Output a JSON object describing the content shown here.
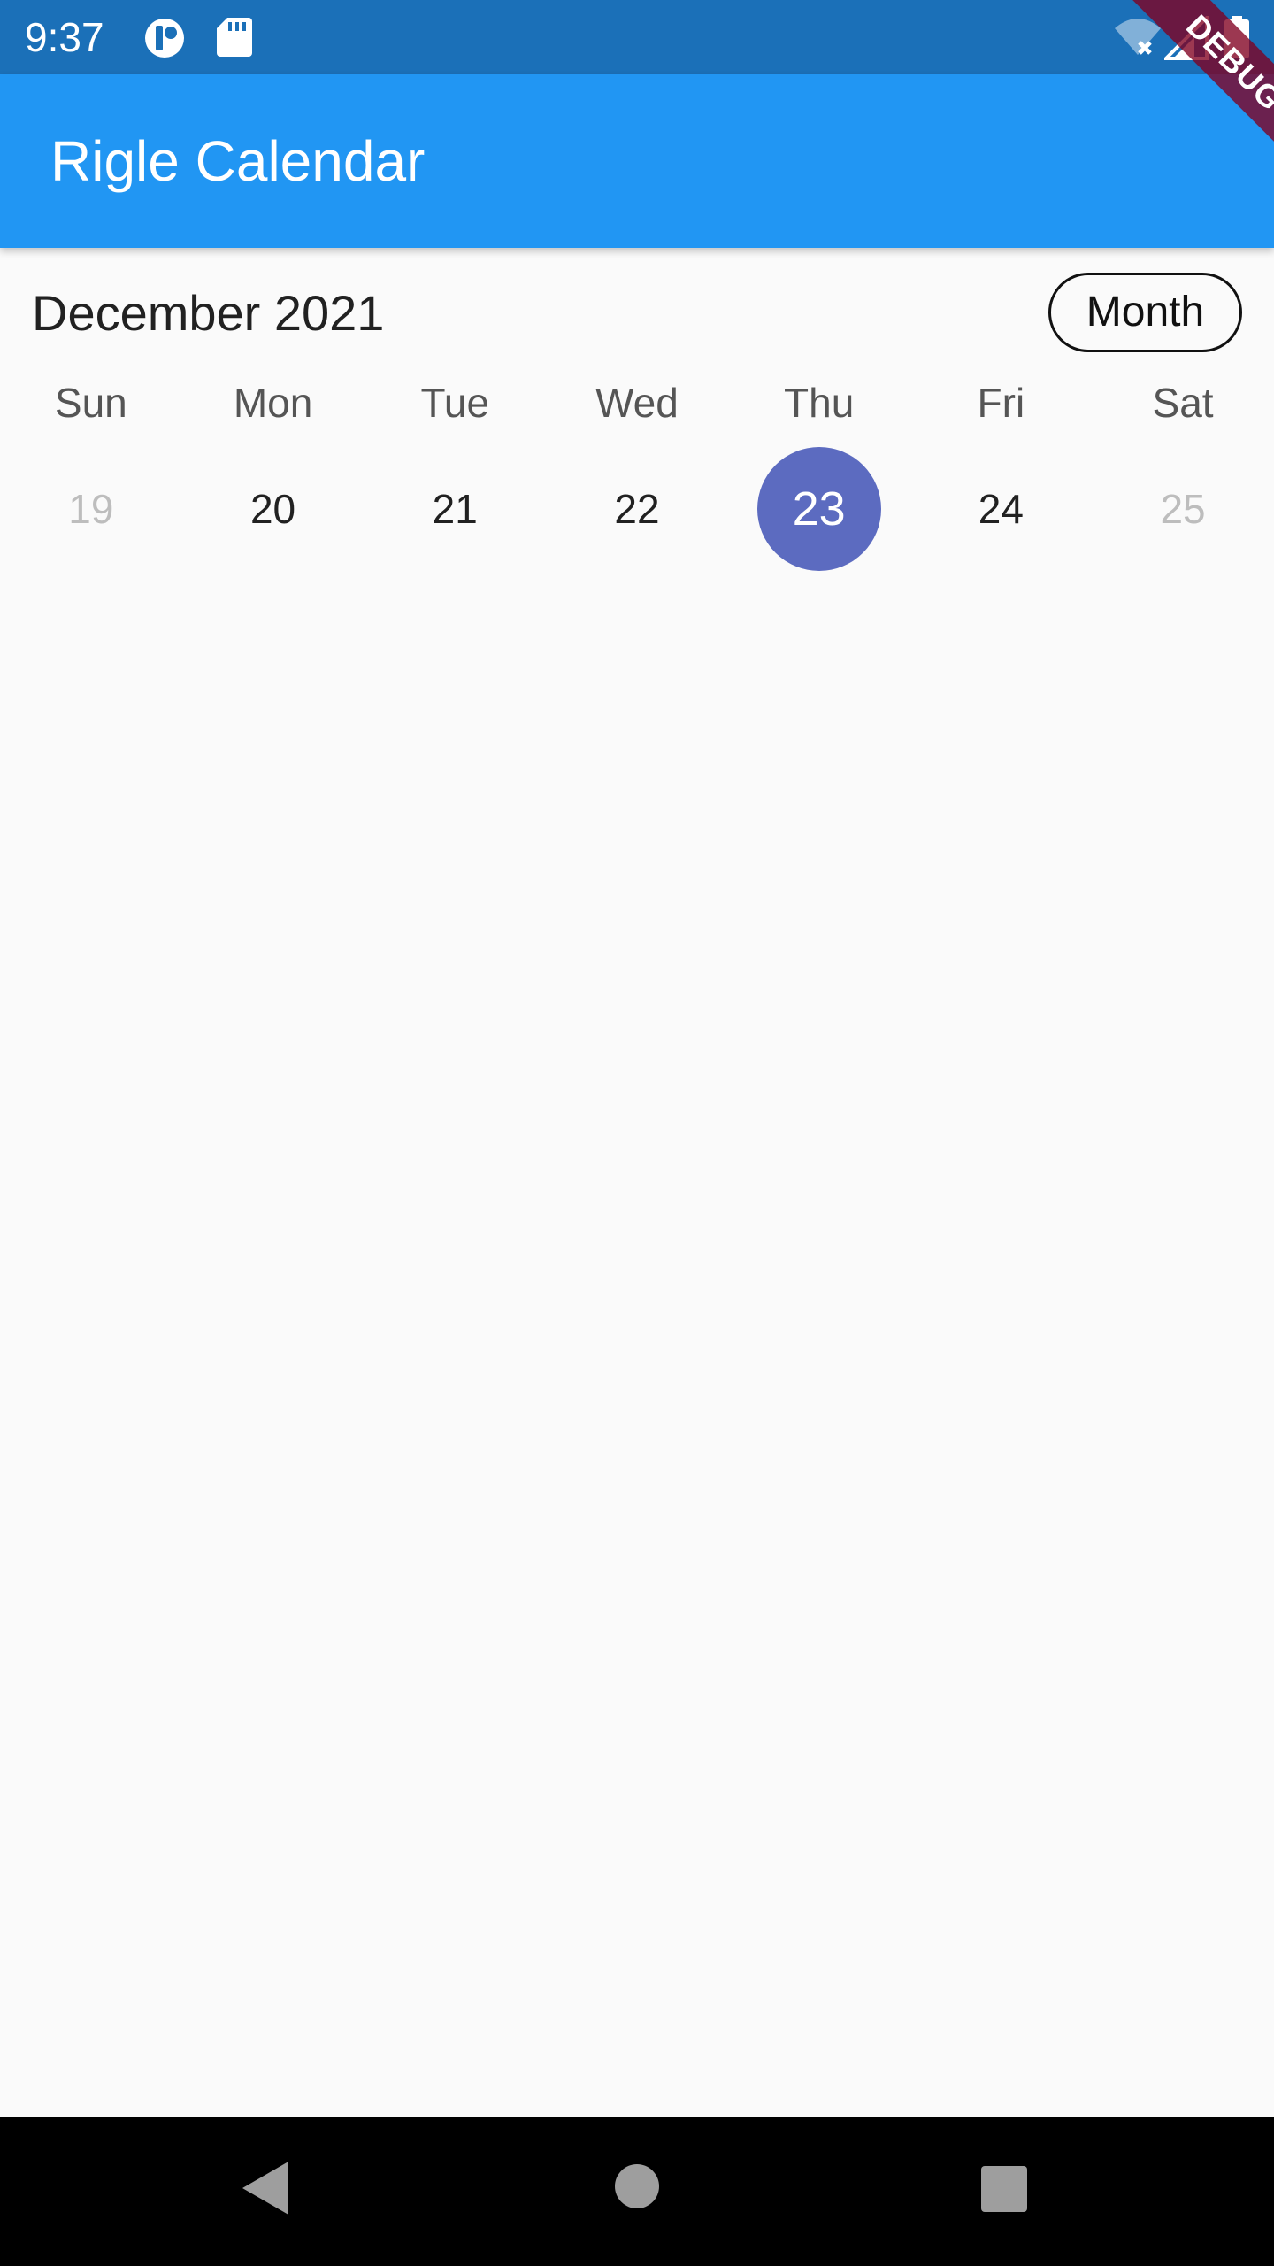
{
  "status_bar": {
    "time": "9:37",
    "background": "#1b70b8",
    "left_icons": [
      "sync-badge-icon",
      "sd-card-icon"
    ],
    "right_icons": [
      "wifi-off-icon",
      "cell-signal-icon",
      "battery-icon"
    ]
  },
  "app_bar": {
    "title": "Rigle Calendar",
    "background": "#2196f3"
  },
  "debug_banner": {
    "label": "DEBUG"
  },
  "calendar": {
    "month_title": "December 2021",
    "view_button": "Month",
    "weekdays": [
      "Sun",
      "Mon",
      "Tue",
      "Wed",
      "Thu",
      "Fri",
      "Sat"
    ],
    "days": [
      {
        "label": "19",
        "muted": true,
        "selected": false
      },
      {
        "label": "20",
        "muted": false,
        "selected": false
      },
      {
        "label": "21",
        "muted": false,
        "selected": false
      },
      {
        "label": "22",
        "muted": false,
        "selected": false
      },
      {
        "label": "23",
        "muted": false,
        "selected": true
      },
      {
        "label": "24",
        "muted": false,
        "selected": false
      },
      {
        "label": "25",
        "muted": true,
        "selected": false
      }
    ],
    "selected_color": "#5c6bc0"
  },
  "nav_bar": {
    "buttons": [
      "back-icon",
      "home-icon",
      "recents-icon"
    ]
  }
}
